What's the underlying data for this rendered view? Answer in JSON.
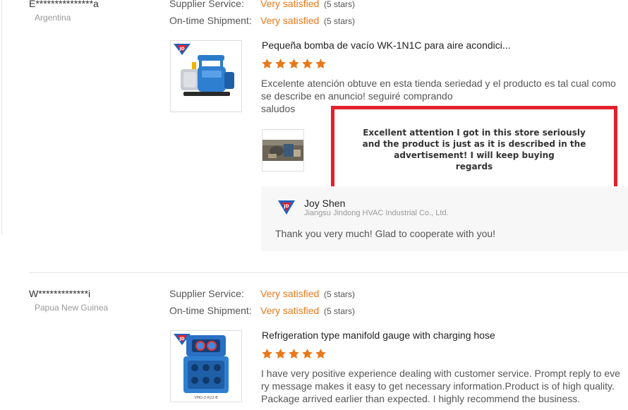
{
  "reviews": [
    {
      "user": "E***************a",
      "country": "Argentina",
      "ratings": [
        {
          "label": "Supplier Service:",
          "value": "Very satisfied",
          "stars": "(5 stars)"
        },
        {
          "label": "On-time Shipment:",
          "value": "Very satisfied",
          "stars": "(5 stars)"
        }
      ],
      "product_title": "Pequeña bomba de vacío WK-1N1C para aire acondici...",
      "rating": 5,
      "review_lines": [
        "Excelente atención obtuve en esta tienda seriedad y el producto es tal cual como",
        "se describe en anuncio! seguiré comprando",
        "saludos"
      ],
      "reply": {
        "name": "Joy Shen",
        "company": "Jiangsu Jindong HVAC Industrial Co., Ltd.",
        "message": "Thank you very much! Glad to cooperate with you!"
      }
    },
    {
      "user": "W*************i",
      "country": "Papua New Guinea",
      "ratings": [
        {
          "label": "Supplier Service:",
          "value": "Very satisfied",
          "stars": "(5 stars)"
        },
        {
          "label": "On-time Shipment:",
          "value": "Very satisfied",
          "stars": "(5 stars)"
        }
      ],
      "product_title": "Refrigeration type manifold gauge with charging hose",
      "rating": 5,
      "review_lines": [
        "I have very positive experience dealing with customer service. Prompt reply to eve",
        "ry message makes it easy to get necessary information.Product is of high quality.",
        "Package arrived earlier than expected. I highly recommend the business."
      ],
      "product_label": "VMG-2-R22-B"
    }
  ],
  "translation_overlay": {
    "lines": [
      "Excellent attention I got in this store seriously",
      "and the product is just as it is described in the",
      "advertisement! I will keep buying",
      "regards"
    ]
  },
  "colors": {
    "accent_orange": "#e8791a",
    "overlay_border": "#e3202b"
  }
}
